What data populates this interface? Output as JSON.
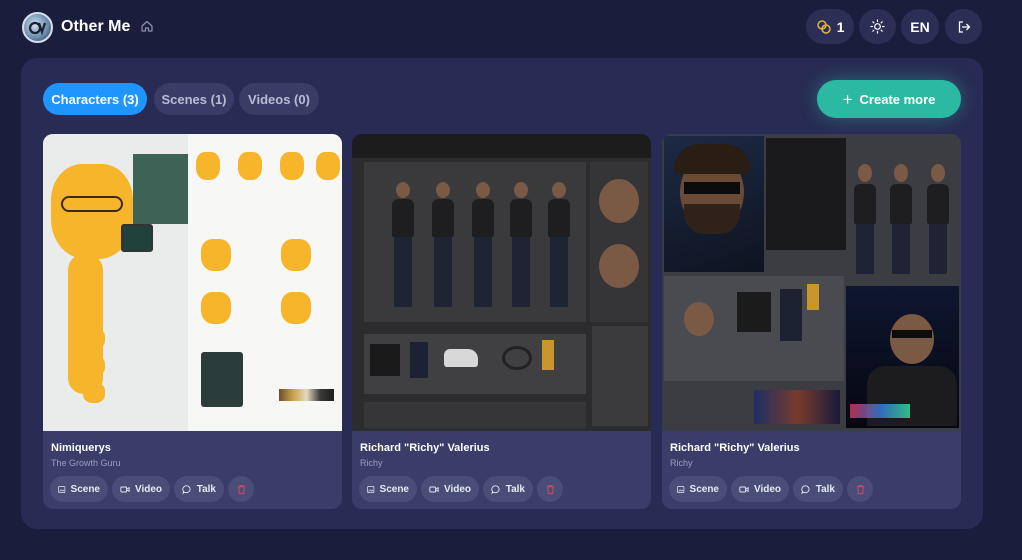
{
  "app": {
    "title": "Other Me"
  },
  "header": {
    "credits": "1",
    "language": "EN"
  },
  "tabs": [
    {
      "label": "Characters (3)",
      "active": true
    },
    {
      "label": "Scenes (1)",
      "active": false
    },
    {
      "label": "Videos (0)",
      "active": false
    }
  ],
  "create_button": {
    "label": "Create more"
  },
  "cards": [
    {
      "name": "Nimiquerys",
      "subtitle": "The Growth Guru",
      "actions": {
        "scene": "Scene",
        "video": "Video",
        "talk": "Talk"
      }
    },
    {
      "name": "Richard \"Richy\" Valerius",
      "subtitle": "Richy",
      "actions": {
        "scene": "Scene",
        "video": "Video",
        "talk": "Talk"
      }
    },
    {
      "name": "Richard \"Richy\" Valerius",
      "subtitle": "Richy",
      "actions": {
        "scene": "Scene",
        "video": "Video",
        "talk": "Talk"
      }
    }
  ],
  "colors": {
    "background": "#1b1d3c",
    "panel": "#282b54",
    "card": "#3a3d69",
    "tab_active": "#1f95ff",
    "create_button": "#2bb9a2",
    "delete": "#d24a5a"
  },
  "icons": {
    "logo": "logo-icon",
    "home": "home-icon",
    "credits": "coins-icon",
    "theme": "sun-icon",
    "logout": "logout-icon",
    "scene": "image-icon",
    "video": "video-camera-icon",
    "talk": "chat-bubble-icon",
    "delete": "trash-icon"
  }
}
